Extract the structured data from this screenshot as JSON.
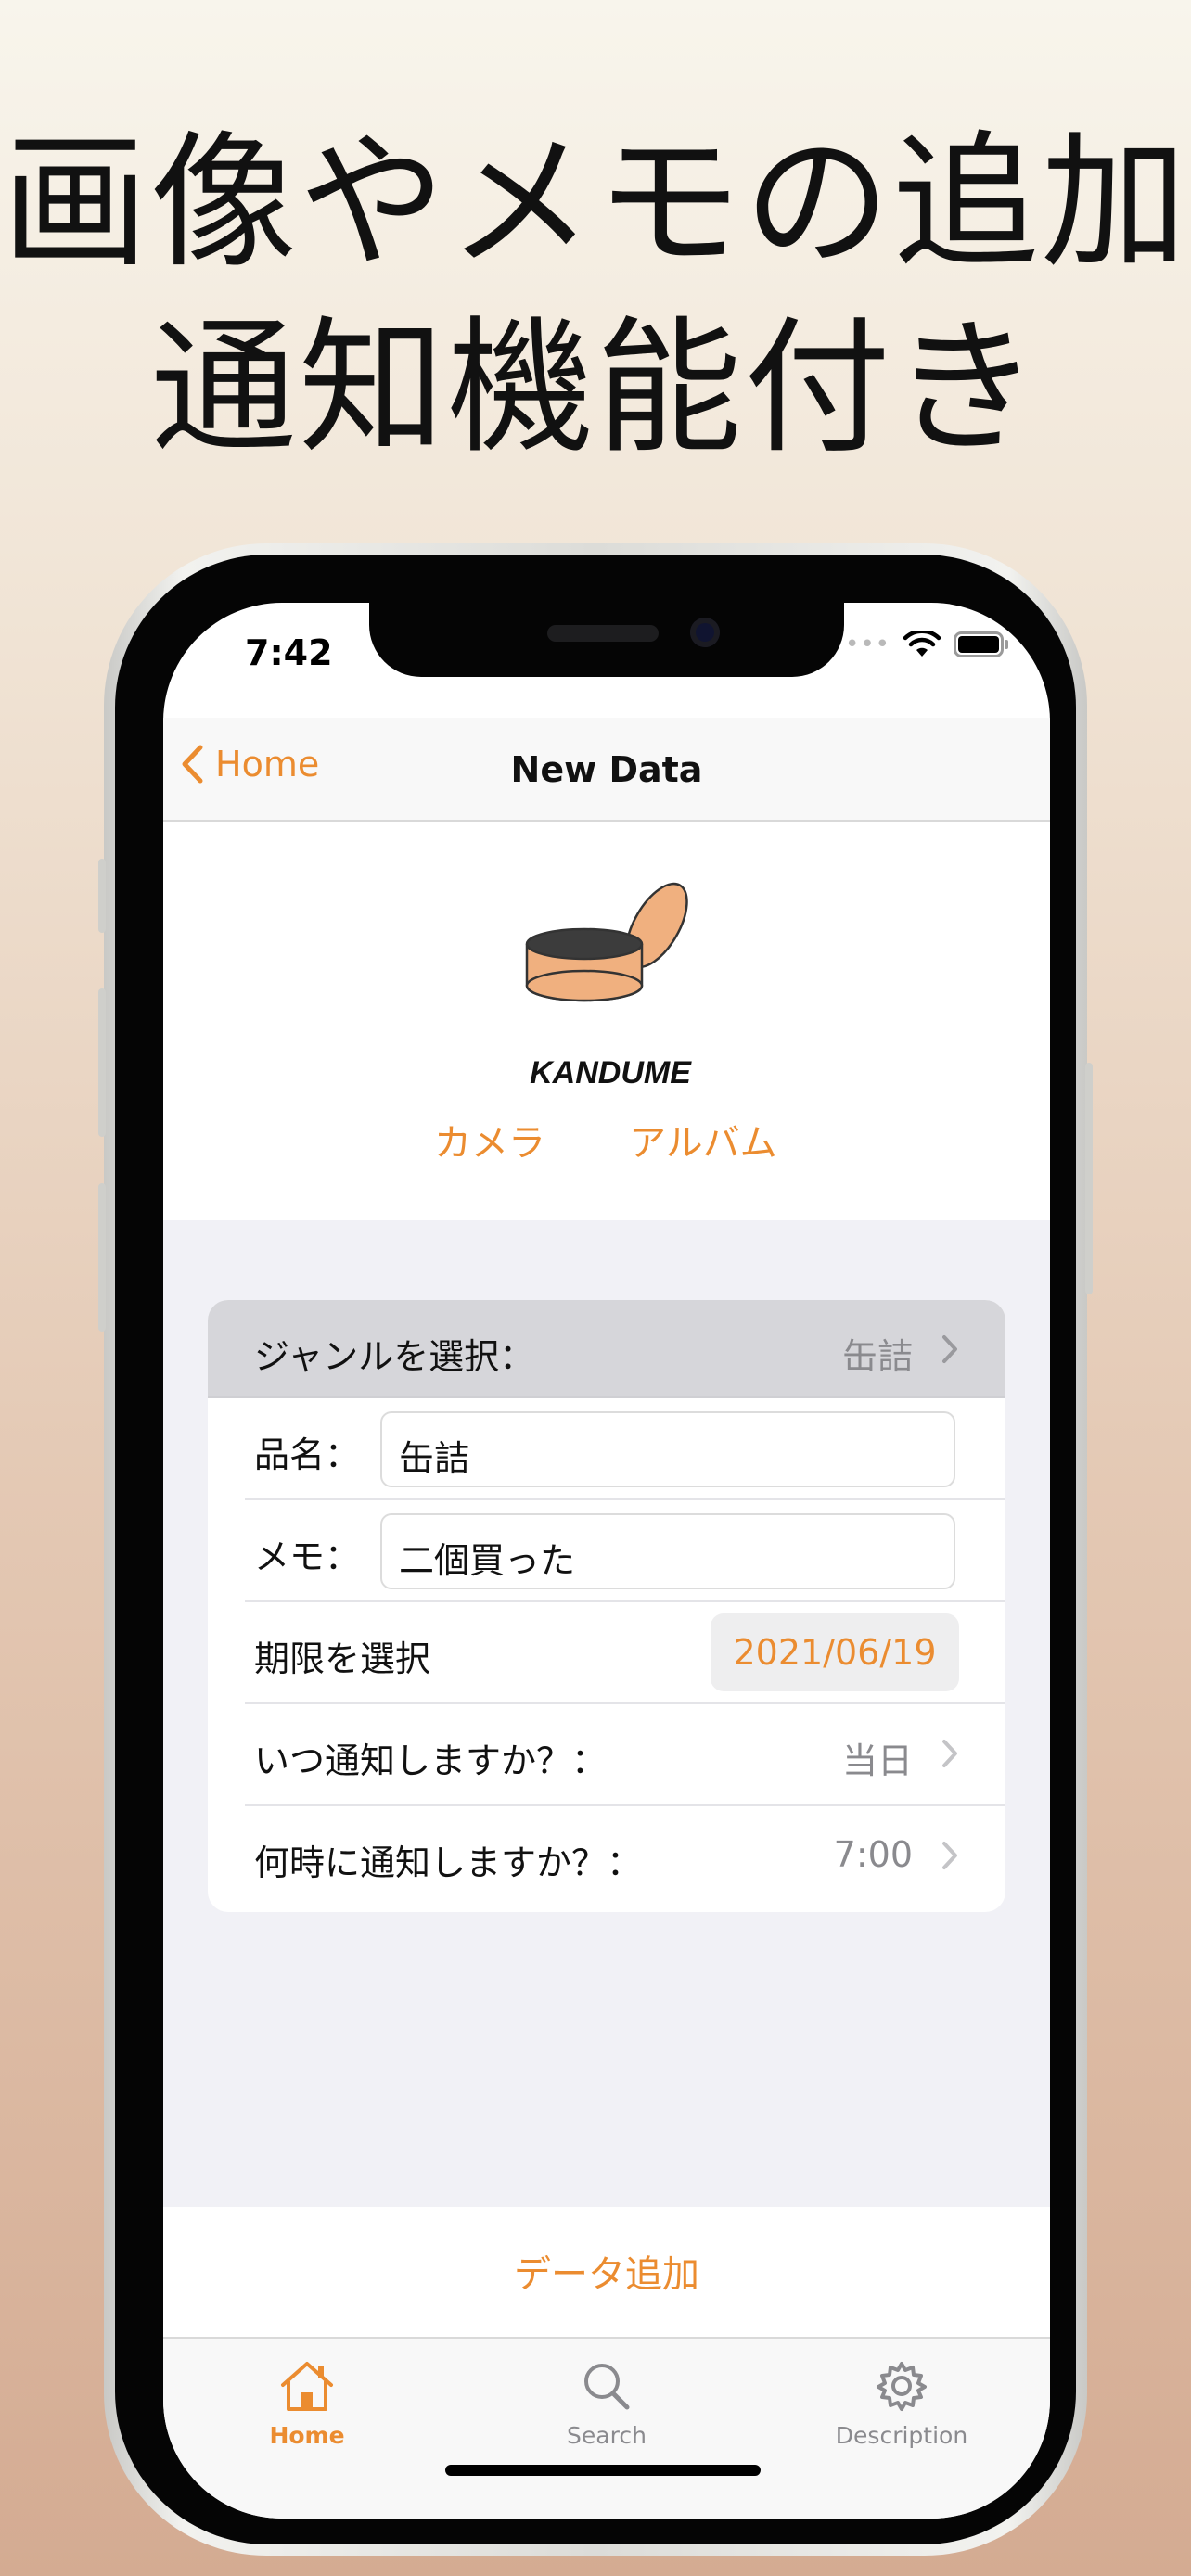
{
  "headline": {
    "line1": "画像やメモの追加",
    "line2": "通知機能付き"
  },
  "status": {
    "time": "7:42",
    "signal": "••••"
  },
  "nav": {
    "back_label": "Home",
    "title": "New Data"
  },
  "logo": {
    "text": "KANDUME"
  },
  "photo": {
    "camera_label": "カメラ",
    "album_label": "アルバム"
  },
  "form": {
    "genre": {
      "label": "ジャンルを選択：",
      "value": "缶詰"
    },
    "name": {
      "label": "品名：",
      "value": "缶詰"
    },
    "memo": {
      "label": "メモ：",
      "value": "二個買った"
    },
    "expiry": {
      "label": "期限を選択",
      "value": "2021/06/19"
    },
    "notify_when": {
      "label": "いつ通知しますか？：",
      "value": "当日"
    },
    "notify_time": {
      "label": "何時に通知しますか？：",
      "value": "7:00"
    }
  },
  "add_button_label": "データ追加",
  "tabs": [
    {
      "label": "Home",
      "icon": "home-icon",
      "active": true
    },
    {
      "label": "Search",
      "icon": "search-icon",
      "active": false
    },
    {
      "label": "Description",
      "icon": "gear-icon",
      "active": false
    }
  ],
  "colors": {
    "accent": "#eb8c30",
    "logo_fill": "#f0b07f",
    "form_bg": "#f1f1f6",
    "genre_row_bg": "#d6d6da"
  }
}
